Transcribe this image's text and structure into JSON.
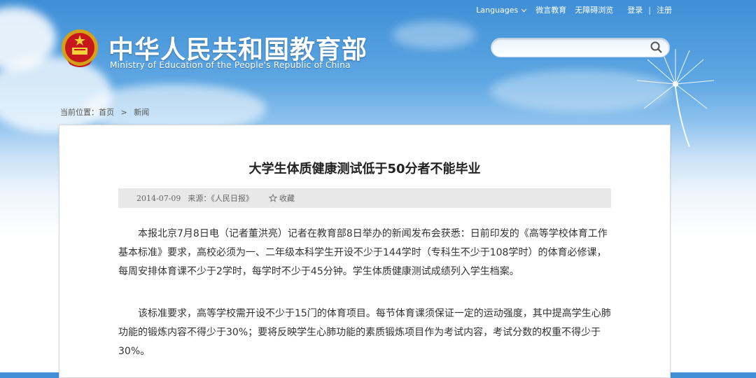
{
  "header": {
    "links": {
      "languages": "Languages",
      "weibo": "微言教育",
      "accessible": "无障碍浏览",
      "login": "登录",
      "sep": "|",
      "register": "注册"
    },
    "title_cn": "中华人民共和国教育部",
    "title_en": "Ministry of Education of the People's Republic of China"
  },
  "search": {
    "placeholder": ""
  },
  "breadcrumb": {
    "label": "当前位置：",
    "home": "首页",
    "sep": ">",
    "current": "新闻"
  },
  "article": {
    "title": "大学生体质健康测试低于50分者不能毕业",
    "date": "2014-07-09",
    "source": "来源：《人民日报》",
    "favorite": "收藏",
    "paragraphs": [
      "本报北京7月8日电（记者董洪亮）记者在教育部8日举办的新闻发布会获悉：日前印发的《高等学校体育工作基本标准》要求，高校必须为一、二年级本科学生开设不少于144学时（专科生不少于108学时）的体育必修课，每周安排体育课不少于2学时，每学时不少于45分钟。学生体质健康测试成绩列入学生档案。",
      "该标准要求，高等学校需开设不少于15门的体育项目。每节体育课须保证一定的运动强度，其中提高学生心肺功能的锻炼内容不得少于30%；要将反映学生心肺功能的素质锻炼项目作为考试内容，考试分数的权重不得少于30%。"
    ]
  }
}
